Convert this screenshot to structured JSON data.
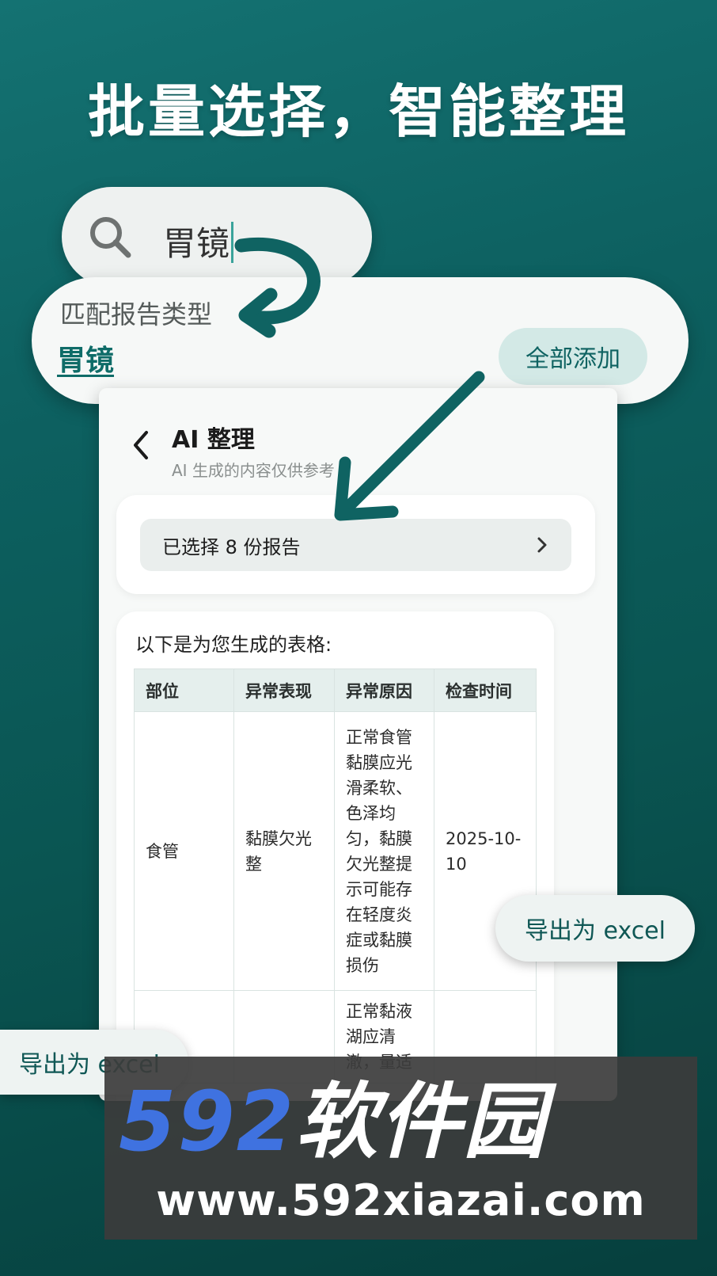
{
  "headline": "批量选择，智能整理",
  "search": {
    "query": "胃镜"
  },
  "match": {
    "label": "匹配报告类型",
    "value": "胃镜",
    "add_all_label": "全部添加"
  },
  "app": {
    "title": "AI 整理",
    "subtitle": "AI 生成的内容仅供参考",
    "selection_text": "已选择 8 份报告",
    "result_intro": "以下是为您生成的表格:",
    "table": {
      "headers": [
        "部位",
        "异常表现",
        "异常原因",
        "检查时间"
      ],
      "rows": [
        [
          "食管",
          "黏膜欠光整",
          "正常食管黏膜应光滑柔软、色泽均匀，黏膜欠光整提示可能存在轻度炎症或黏膜损伤",
          "2025-10-10"
        ],
        [
          "",
          "",
          "正常黏液湖应清澈，量适",
          ""
        ]
      ]
    }
  },
  "export": {
    "right_label": "导出为 excel",
    "bottom_label": "导出为 excel"
  },
  "watermark": {
    "number": "592",
    "brand": "软件园",
    "url": "www.592xiazai.com"
  },
  "colors": {
    "background": "#0d6060",
    "accent": "#0f6c68",
    "pill": "#d3e9e6",
    "watermark_blue": "#3f72e0"
  }
}
